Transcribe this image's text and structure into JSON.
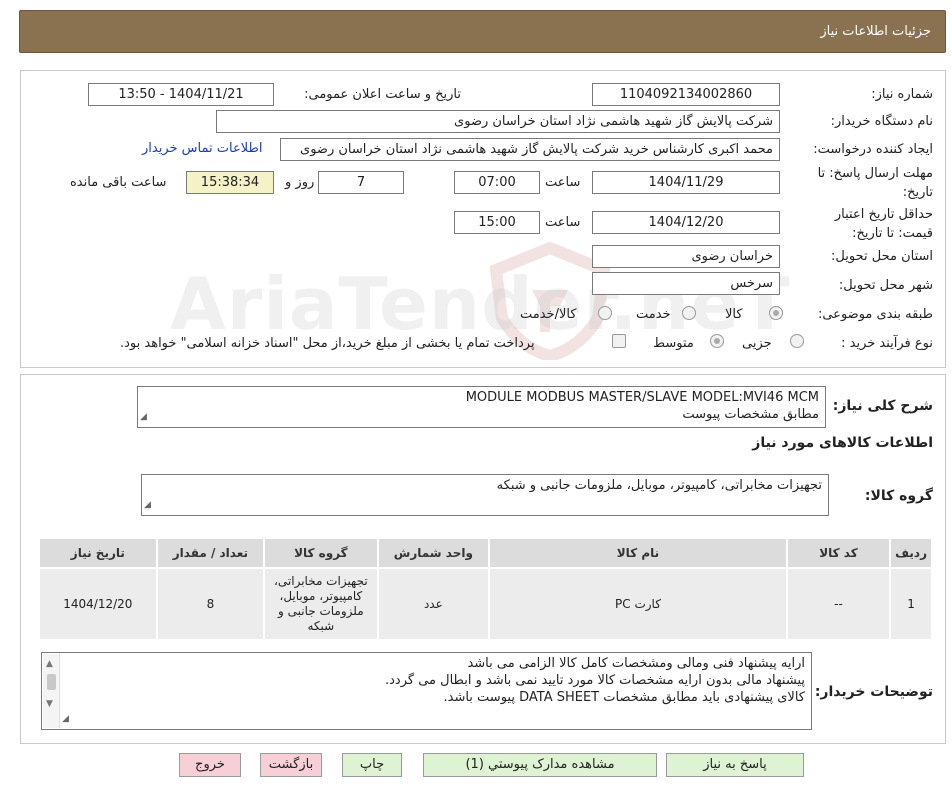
{
  "header": {
    "title": "جزئیات اطلاعات نیاز"
  },
  "form": {
    "need_number_label": "شماره نیاز:",
    "need_number": "1104092134002860",
    "announce_label": "تاریخ و ساعت اعلان عمومی:",
    "announce_value": "1404/11/21 - 13:50",
    "buyer_org_label": "نام دستگاه خریدار:",
    "buyer_org": "شرکت پالایش گاز شهید هاشمی نژاد   استان خراسان رضوی",
    "creator_label": "ایجاد کننده درخواست:",
    "creator": "محمد اکبری کارشناس خرید شرکت پالایش گاز شهید هاشمی نژاد   استان خراسان رضوی",
    "contact_link": "اطلاعات تماس خریدار",
    "deadline_label_1": "مهلت ارسال پاسخ: تا",
    "deadline_label_2": "تاریخ:",
    "deadline_date": "1404/11/29",
    "time_label": "ساعت",
    "deadline_time": "07:00",
    "days_value": "7",
    "days_label": "روز و",
    "remaining_time": "15:38:34",
    "remaining_label": "ساعت باقی مانده",
    "validity_label_1": "حداقل تاریخ اعتبار",
    "validity_label_2": "قیمت: تا تاریخ:",
    "validity_date": "1404/12/20",
    "validity_time": "15:00",
    "province_label": "استان محل تحویل:",
    "province": "خراسان رضوی",
    "city_label": "شهر محل تحویل:",
    "city": "سرخس",
    "category_label": "طبقه بندی موضوعی:",
    "cat_goods": "کالا",
    "cat_service": "خدمت",
    "cat_goods_service": "کالا/خدمت",
    "process_label": "نوع فرآیند خرید :",
    "proc_partial": "جزیی",
    "proc_medium": "متوسط",
    "payment_note": "پرداخت تمام یا بخشی از مبلغ خرید،از محل \"اسناد خزانه اسلامی\" خواهد بود."
  },
  "summary": {
    "label": "شرح کلی نیاز:",
    "line1": "MODULE MODBUS MASTER/SLAVE MODEL:MVI46 MCM",
    "line2": "مطابق مشخصات پیوست"
  },
  "goods_info": {
    "title": "اطلاعات کالاهای مورد نیاز",
    "group_label": "گروه کالا:",
    "group_value": "تجهیزات مخابراتی، کامپیوتر، موبایل، ملزومات جانبی و شبکه"
  },
  "table": {
    "headers": [
      "ردیف",
      "کد کالا",
      "نام کالا",
      "واحد شمارش",
      "گروه کالا",
      "تعداد / مقدار",
      "تاریخ نیاز"
    ],
    "rows": [
      [
        "1",
        "--",
        "کارت PC",
        "عدد",
        "تجهیزات مخابراتی، کامپیوتر، موبایل، ملزومات جانبی و شبکه",
        "8",
        "1404/12/20"
      ]
    ]
  },
  "buyer_notes": {
    "label": "توضیحات خریدار:",
    "line1": "ارایه پیشنهاد فنی ومالی ومشخصات کامل کالا الزامی می باشد",
    "line2": "پیشنهاد مالی بدون ارایه مشخصات کالا مورد تایید نمی باشد و ابطال می گردد.",
    "line3": "کالای پیشنهادی باید مطابق مشخصات DATA SHEET پیوست باشد."
  },
  "buttons": {
    "reply": "پاسخ به نیاز",
    "attachments": "مشاهده مدارک پیوستي (1)",
    "print": "چاپ",
    "back": "بازگشت",
    "exit": "خروج"
  },
  "watermark": {
    "text": "AriaTender.neT"
  },
  "colors": {
    "header": "#8a7150",
    "green_button": "#def3d3",
    "pink_button": "#f6d0d6",
    "link": "#1a3dbf",
    "time_highlight": "#f4f2c6"
  }
}
